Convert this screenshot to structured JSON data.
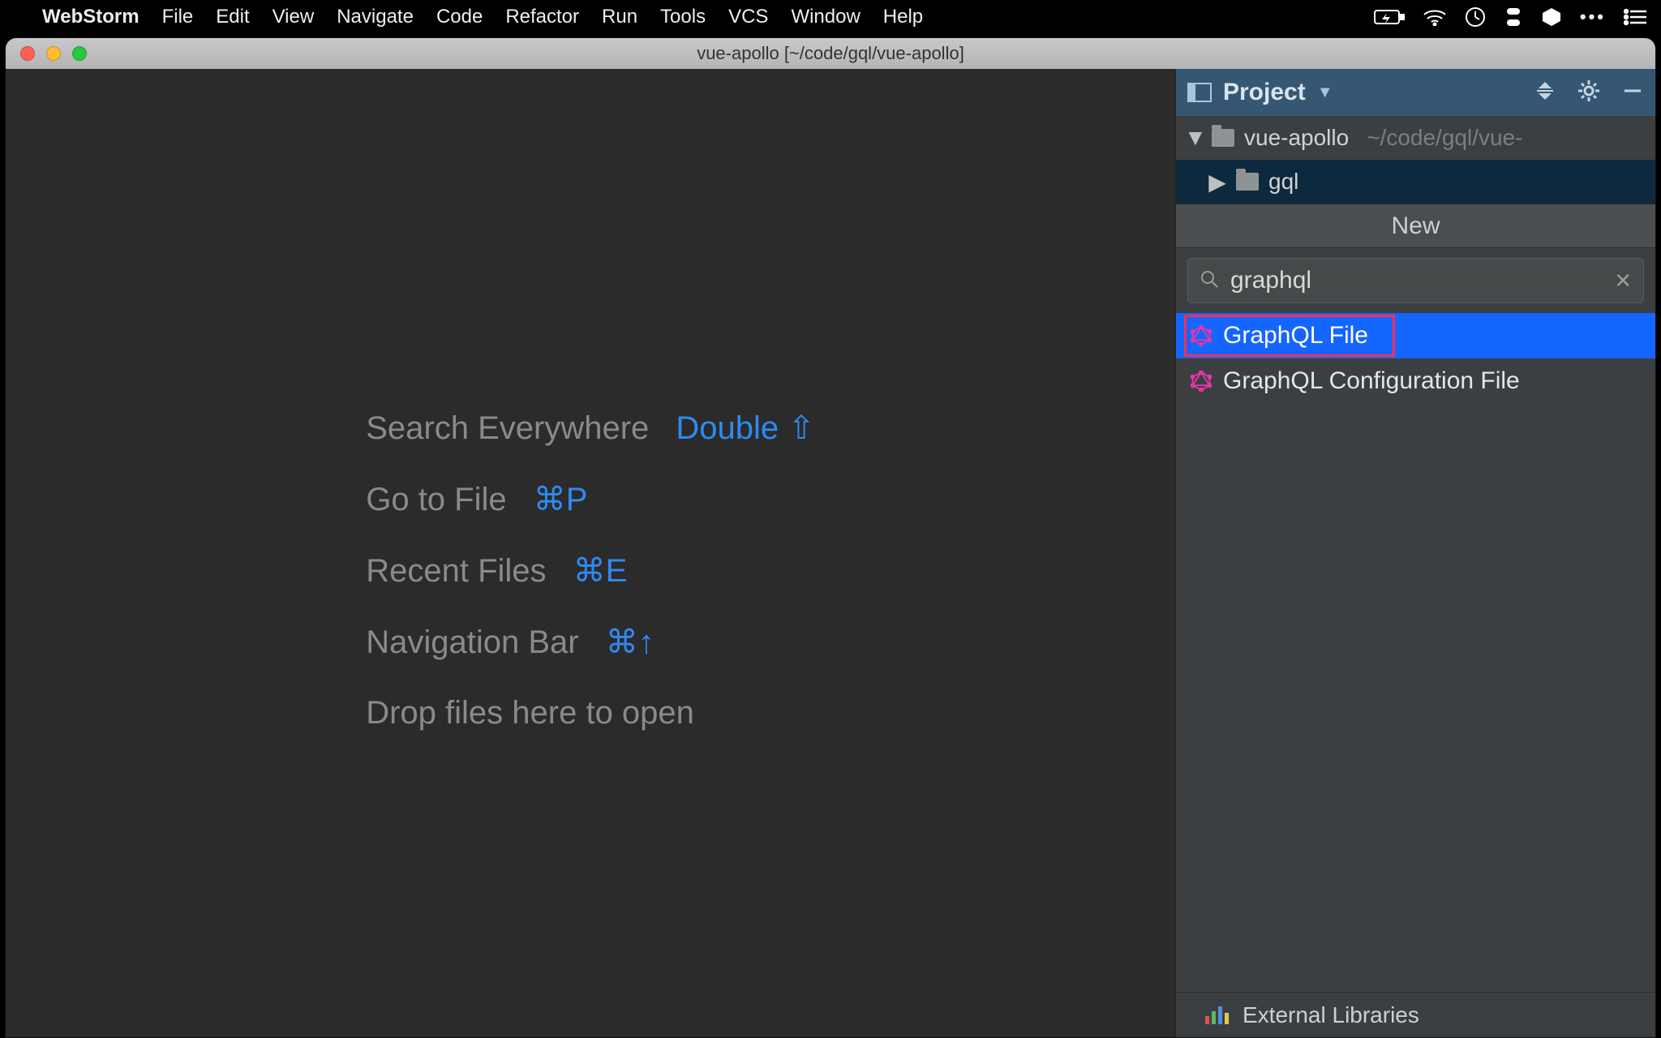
{
  "menubar": {
    "app": "WebStorm",
    "menus": [
      "File",
      "Edit",
      "View",
      "Navigate",
      "Code",
      "Refactor",
      "Run",
      "Tools",
      "VCS",
      "Window",
      "Help"
    ]
  },
  "window": {
    "title": "vue-apollo [~/code/gql/vue-apollo]"
  },
  "welcome": {
    "rows": [
      {
        "label": "Search Everywhere",
        "shortcut": "Double ⇧"
      },
      {
        "label": "Go to File",
        "shortcut": "⌘P"
      },
      {
        "label": "Recent Files",
        "shortcut": "⌘E"
      },
      {
        "label": "Navigation Bar",
        "shortcut": "⌘↑"
      }
    ],
    "drop": "Drop files here to open"
  },
  "sidebar": {
    "panel_title": "Project",
    "tree": {
      "root_name": "vue-apollo",
      "root_path": "~/code/gql/vue-",
      "child_name": "gql"
    },
    "external_libraries": "External Libraries"
  },
  "popup": {
    "title": "New",
    "search_value": "graphql",
    "items": [
      {
        "label": "GraphQL File",
        "highlight": true
      },
      {
        "label": "GraphQL Configuration File",
        "highlight": false
      }
    ]
  }
}
